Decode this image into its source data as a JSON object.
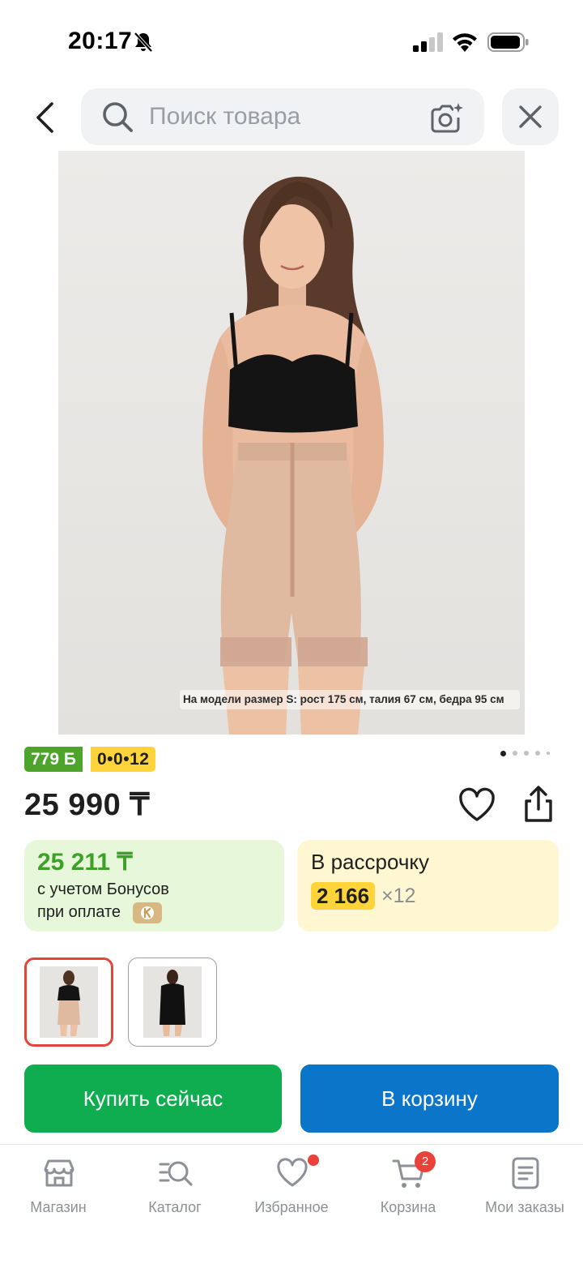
{
  "status_bar": {
    "time": "20:17",
    "icons": [
      "bell-slash-icon",
      "signal-icon",
      "wifi-icon",
      "battery-icon"
    ]
  },
  "header": {
    "search": {
      "placeholder": "Поиск товара",
      "value": ""
    },
    "icons": [
      "chevron-left-icon",
      "search-icon",
      "camera-icon",
      "close-icon"
    ]
  },
  "product": {
    "photo_caption": "На модели размер S: рост 175 см, талия 67 см, бедра 95 см",
    "bonus_badge": "779 Б",
    "installment_badge": "0•0•12",
    "pager": {
      "total": 5,
      "current": 1
    },
    "price": "25 990 ₸",
    "bonus_card": {
      "price": "25 211 ₸",
      "line1": "с учетом Бонусов",
      "line2": "при оплате"
    },
    "installment_card": {
      "title": "В рассрочку",
      "amount": "2 166",
      "term": "×12"
    },
    "thumbnails": [
      {
        "name": "beige-variant",
        "selected": true
      },
      {
        "name": "black-variant",
        "selected": false
      }
    ]
  },
  "actions": {
    "buy_now": "Купить сейчас",
    "add_to_cart": "В корзину"
  },
  "bottom_nav": {
    "items": [
      {
        "label": "Магазин",
        "icon": "store-icon"
      },
      {
        "label": "Каталог",
        "icon": "catalog-search-icon"
      },
      {
        "label": "Избранное",
        "icon": "heart-icon"
      },
      {
        "label": "Корзина",
        "icon": "cart-icon"
      },
      {
        "label": "Мои заказы",
        "icon": "orders-list-icon"
      }
    ],
    "cart_count": "2"
  },
  "colors": {
    "buy_now": "#0fad4f",
    "add_to_cart": "#0b75c9",
    "bonus_green": "#4ca52a",
    "installment_yellow": "#ffd43b",
    "badge_red": "#e8423a"
  }
}
